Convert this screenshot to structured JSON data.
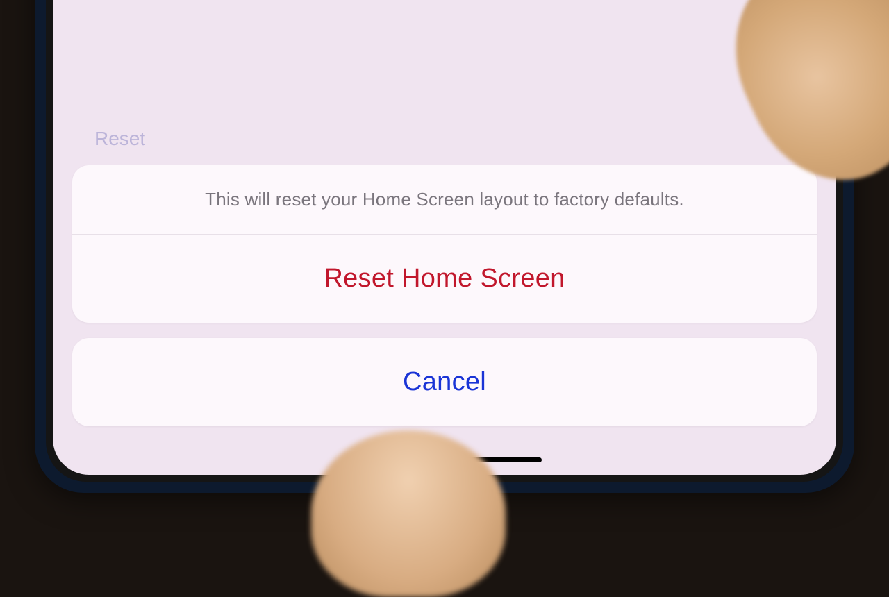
{
  "actionSheet": {
    "message": "This will reset your Home Screen layout to factory defaults.",
    "destructiveAction": "Reset Home Screen",
    "cancelAction": "Cancel"
  },
  "background": {
    "partialText": "Reset"
  }
}
